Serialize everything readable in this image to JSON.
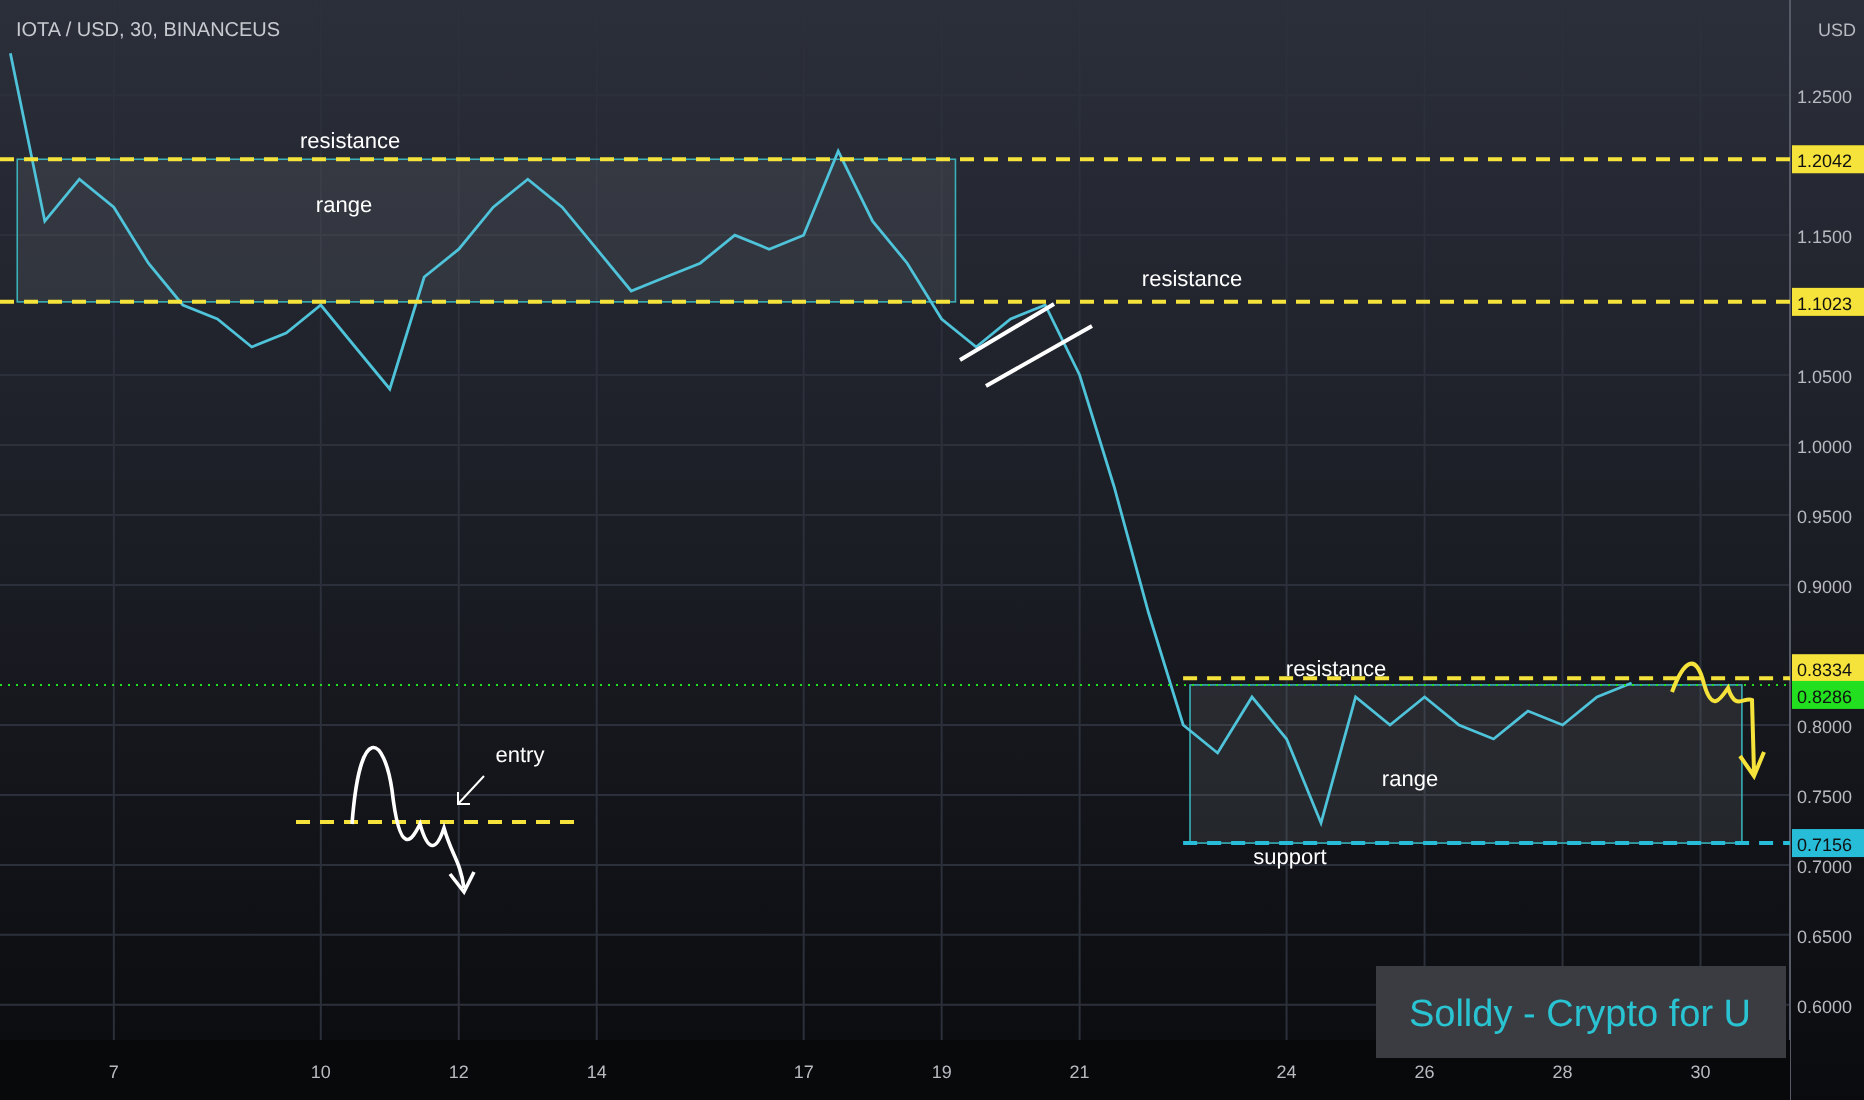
{
  "chart": {
    "symbol": "IOTA / USD, 30, BINANCEUS",
    "currency": "USD",
    "chart_data": {
      "type": "line",
      "grid": true,
      "x": [
        5.5,
        6,
        6.5,
        7,
        7.5,
        8,
        8.5,
        9,
        9.5,
        10,
        10.5,
        11,
        11.5,
        12,
        12.5,
        13,
        13.5,
        14,
        14.5,
        15,
        15.5,
        16,
        16.5,
        17,
        17.5,
        18,
        18.5,
        19,
        19.5,
        20,
        20.5,
        21,
        21.5,
        22,
        22.5,
        23,
        23.5,
        24,
        24.5,
        25,
        25.5,
        26,
        26.5,
        27,
        27.5,
        28,
        28.5,
        29
      ],
      "series": [
        {
          "color": "#4fc3d9",
          "values": [
            1.28,
            1.16,
            1.19,
            1.17,
            1.13,
            1.1,
            1.09,
            1.07,
            1.08,
            1.1,
            1.07,
            1.04,
            1.12,
            1.14,
            1.17,
            1.19,
            1.17,
            1.14,
            1.11,
            1.12,
            1.13,
            1.15,
            1.14,
            1.15,
            1.21,
            1.16,
            1.13,
            1.09,
            1.07,
            1.09,
            1.1,
            1.05,
            0.97,
            0.88,
            0.8,
            0.78,
            0.82,
            0.79,
            0.73,
            0.82,
            0.8,
            0.82,
            0.8,
            0.79,
            0.81,
            0.8,
            0.82,
            0.83
          ]
        }
      ],
      "xlim": [
        5.35,
        32.37
      ],
      "ylim": [
        0.532,
        1.318
      ],
      "xticks": [
        {
          "value": 7,
          "label": "7"
        },
        {
          "value": 10,
          "label": "10"
        },
        {
          "value": 12,
          "label": "12"
        },
        {
          "value": 14,
          "label": "14"
        },
        {
          "value": 17,
          "label": "17"
        },
        {
          "value": 19,
          "label": "19"
        },
        {
          "value": 21,
          "label": "21"
        },
        {
          "value": 24,
          "label": "24"
        },
        {
          "value": 26,
          "label": "26"
        },
        {
          "value": 28,
          "label": "28"
        },
        {
          "value": 30,
          "label": "30"
        }
      ],
      "yticks": [
        {
          "value": 1.25,
          "label": "1.2500"
        },
        {
          "value": 1.15,
          "label": "1.1500"
        },
        {
          "value": 1.05,
          "label": "1.0500"
        },
        {
          "value": 1,
          "label": "1.0000"
        },
        {
          "value": 0.95,
          "label": "0.9500"
        },
        {
          "value": 0.9,
          "label": "0.9000"
        },
        {
          "value": 0.8,
          "label": "0.8000"
        },
        {
          "value": 0.75,
          "label": "0.7500"
        },
        {
          "value": 0.7,
          "label": "0.7000"
        },
        {
          "value": 0.65,
          "label": "0.6500"
        },
        {
          "value": 0.6,
          "label": "0.6000"
        }
      ],
      "ref_lines": [
        {
          "axis": "y",
          "value": 1.2042,
          "label": "1.2042",
          "color": "#f5e33b"
        },
        {
          "axis": "y",
          "value": 1.1023,
          "label": "1.1023",
          "color": "#f5e33b"
        },
        {
          "axis": "y",
          "value": 0.8334,
          "label": "0.8334",
          "color": "#f5e33b"
        },
        {
          "axis": "y",
          "value": 0.8286,
          "label": "0.8286",
          "color": "#22e01f"
        },
        {
          "axis": "y",
          "value": 0.7156,
          "label": "0.7156",
          "color": "#27bcd8"
        }
      ],
      "annotations": [
        "resistance",
        "range",
        "resistance",
        "resistance",
        "range",
        "support",
        "entry"
      ]
    },
    "signature": "Solldy - Crypto for U"
  }
}
